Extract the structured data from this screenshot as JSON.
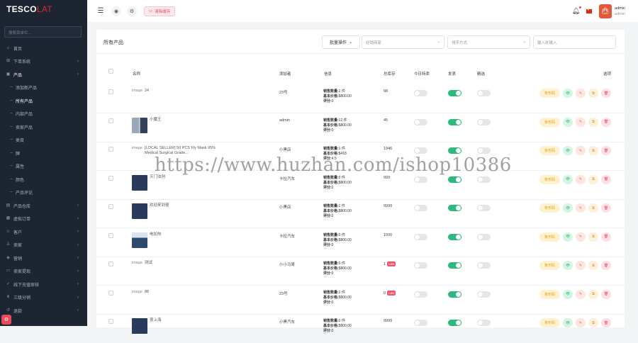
{
  "brand": {
    "logo_main": "TESCO",
    "logo_accent": "LAT"
  },
  "sidebar": {
    "search_placeholder": "搜索菜单栏...",
    "items": [
      {
        "label": "首页",
        "icon": "home-icon",
        "sub": false,
        "chevron": false,
        "active": false
      },
      {
        "label": "下单系统",
        "icon": "cart-icon",
        "sub": false,
        "chevron": true,
        "active": false
      },
      {
        "label": "产品",
        "icon": "box-icon",
        "sub": false,
        "chevron": true,
        "active": true
      },
      {
        "label": "添加新产品",
        "icon": "dot-icon",
        "sub": true,
        "chevron": false,
        "active": false
      },
      {
        "label": "所有产品",
        "icon": "dot-icon",
        "sub": true,
        "chevron": false,
        "active": true
      },
      {
        "label": "内部产品",
        "icon": "dot-icon",
        "sub": true,
        "chevron": false,
        "active": false
      },
      {
        "label": "卖家产品",
        "icon": "dot-icon",
        "sub": true,
        "chevron": false,
        "active": false
      },
      {
        "label": "类目",
        "icon": "dot-icon",
        "sub": true,
        "chevron": false,
        "active": false
      },
      {
        "label": "牌",
        "icon": "dot-icon",
        "sub": true,
        "chevron": false,
        "active": false
      },
      {
        "label": "属性",
        "icon": "dot-icon",
        "sub": true,
        "chevron": false,
        "active": false
      },
      {
        "label": "颜色",
        "icon": "dot-icon",
        "sub": true,
        "chevron": false,
        "active": false
      },
      {
        "label": "产品评论",
        "icon": "dot-icon",
        "sub": true,
        "chevron": false,
        "active": false
      },
      {
        "label": "产品仓库",
        "icon": "warehouse-icon",
        "sub": false,
        "chevron": true,
        "active": false
      },
      {
        "label": "虚拟订单",
        "icon": "order-icon",
        "sub": false,
        "chevron": true,
        "active": false
      },
      {
        "label": "客户",
        "icon": "user-icon",
        "sub": false,
        "chevron": true,
        "active": false
      },
      {
        "label": "卖家",
        "icon": "seller-icon",
        "sub": false,
        "chevron": true,
        "active": false
      },
      {
        "label": "营销",
        "icon": "megaphone-icon",
        "sub": false,
        "chevron": true,
        "active": false
      },
      {
        "label": "卖家提现",
        "icon": "wallet-icon",
        "sub": false,
        "chevron": true,
        "active": false
      },
      {
        "label": "线下充值审核",
        "icon": "check-icon",
        "sub": false,
        "chevron": true,
        "active": false
      },
      {
        "label": "三级分销",
        "icon": "tree-icon",
        "sub": false,
        "chevron": true,
        "active": false
      },
      {
        "label": "退款",
        "icon": "refund-icon",
        "sub": false,
        "chevron": true,
        "active": false
      }
    ]
  },
  "topbar": {
    "clear_cache_label": "清除缓存",
    "user_name": "admin",
    "user_role": "admin"
  },
  "card": {
    "title": "所有产品",
    "bulk_label": "批量操作",
    "filter1_placeholder": "经销商家",
    "filter2_placeholder": "排序方式",
    "search_placeholder": "输入并输入"
  },
  "table": {
    "headers": {
      "name": "名称",
      "added_by": "添加者",
      "info": "信息",
      "stock": "总库存",
      "today_deal": "今日特卖",
      "published": "发表",
      "featured": "精选",
      "options": "选项"
    },
    "info_labels": {
      "sales": "销售数量:",
      "base_price": "基本价格:",
      "rating": "评分:"
    },
    "low_badge": "Low",
    "actions": {
      "print": "条形码"
    },
    "rows": [
      {
        "image": "ph",
        "name": "24",
        "added_by": "23号",
        "sales": "1 件",
        "price": "$800.00",
        "rating": "0",
        "stock": "98",
        "low": false,
        "today": false,
        "published": true,
        "featured": false
      },
      {
        "image": "pair",
        "name": "小魔王",
        "added_by": "admin",
        "sales": "12 件",
        "price": "$800.00",
        "rating": "0",
        "stock": "45",
        "low": false,
        "today": false,
        "published": true,
        "featured": false
      },
      {
        "image": "ph",
        "name": "[LOCAL SELLER] 50 PCS Fly Mask 95% Medical Surgical Grade...",
        "added_by": "小黑店",
        "sales": "1 件",
        "price": "$418",
        "rating": "4.5",
        "stock": "1946",
        "low": false,
        "today": false,
        "published": true,
        "featured": false
      },
      {
        "image": "dark",
        "name": "灭门法则",
        "added_by": "卡拉汽车",
        "sales": "0 件",
        "price": "$800.00",
        "rating": "0",
        "stock": "999",
        "low": false,
        "today": false,
        "published": true,
        "featured": false
      },
      {
        "image": "dark",
        "name": "欢迎来到夜",
        "added_by": "小黑店",
        "sales": "1 件",
        "price": "$800.00",
        "rating": "0",
        "stock": "9999",
        "low": false,
        "today": false,
        "published": true,
        "featured": false
      },
      {
        "image": "cam",
        "name": "电加热",
        "added_by": "卡拉汽车",
        "sales": "0 件",
        "price": "$800.00",
        "rating": "0",
        "stock": "1000",
        "low": false,
        "today": false,
        "published": true,
        "featured": false
      },
      {
        "image": "ph",
        "name": "测试",
        "added_by": "小小马哥",
        "sales": "0 件",
        "price": "$800.00",
        "rating": "0",
        "stock": "1",
        "low": true,
        "today": false,
        "published": true,
        "featured": false
      },
      {
        "image": "ph",
        "name": "88",
        "added_by": "23号",
        "sales": "1 件",
        "price": "$800.00",
        "rating": "0",
        "stock": "0",
        "low": true,
        "today": false,
        "published": true,
        "featured": false
      },
      {
        "image": "dark",
        "name": "夜上海",
        "added_by": "小黑汽车",
        "sales": "0 件",
        "price": "$800.00",
        "rating": "0",
        "stock": "9999",
        "low": false,
        "today": false,
        "published": true,
        "featured": false
      }
    ]
  },
  "watermark": "https://www.huzhan.com/ishop10386",
  "image_placeholder_text": "image"
}
